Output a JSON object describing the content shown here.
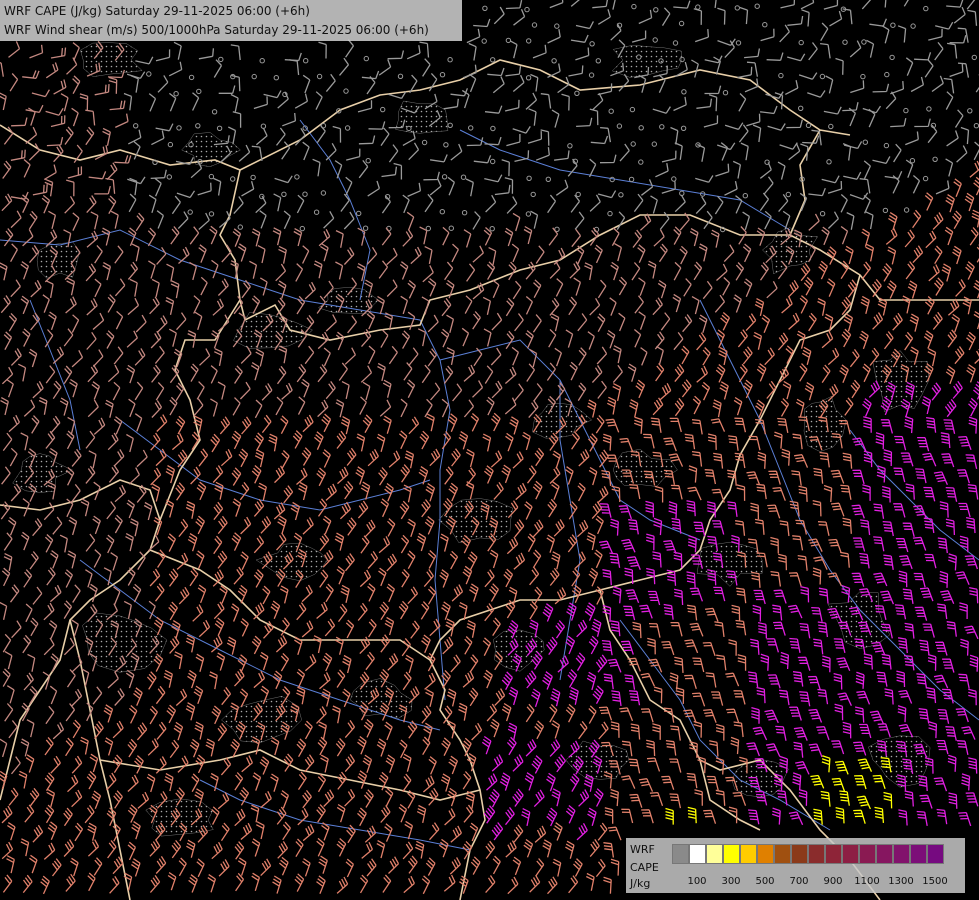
{
  "titles": {
    "line1": "WRF CAPE (J/kg) Saturday 29-11-2025 06:00 (+6h)",
    "line2": "WRF Wind shear (m/s) 500/1000hPa Saturday 29-11-2025 06:00 (+6h)"
  },
  "legend": {
    "label_line1": "WRF",
    "label_line2": "CAPE",
    "label_line3": "J/kg",
    "swatches": [
      "#8a8a8a",
      "#ffffff",
      "#ffff99",
      "#ffff00",
      "#ffcc00",
      "#e08000",
      "#a05010",
      "#8b3a1a",
      "#8a2c2c",
      "#8e2438",
      "#8d1f44",
      "#8a1a52",
      "#861660",
      "#82126c",
      "#7c0e78",
      "#760a80"
    ],
    "ticks": [
      {
        "label": "100",
        "slot": 1
      },
      {
        "label": "300",
        "slot": 3
      },
      {
        "label": "500",
        "slot": 5
      },
      {
        "label": "700",
        "slot": 7
      },
      {
        "label": "900",
        "slot": 9
      },
      {
        "label": "1100",
        "slot": 11
      },
      {
        "label": "1300",
        "slot": 13
      },
      {
        "label": "1500",
        "slot": 15
      }
    ]
  },
  "colors": {
    "background": "#000000",
    "border": "#e8cfa8",
    "river": "#5b7fd6",
    "barb_calm": "#9a9a9a",
    "barb_moderate": "#c48880",
    "barb_strong": "#e0806a",
    "barb_magenta": "#e020e0",
    "barb_yellow": "#ffff00"
  }
}
